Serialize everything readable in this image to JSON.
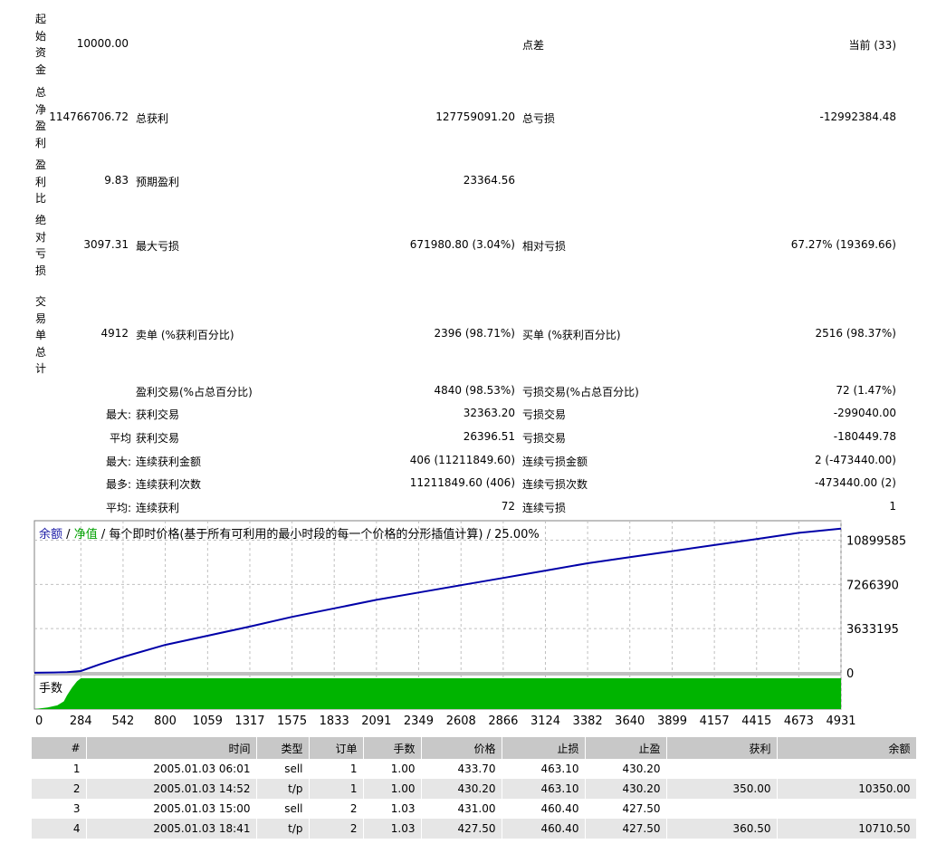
{
  "summary": {
    "initial_deposit": {
      "label": "起始资金",
      "value": "10000.00"
    },
    "spread": {
      "label": "点差",
      "value": "当前 (33)"
    },
    "net_profit": {
      "label": "总净盈利",
      "value": "114766706.72"
    },
    "gross_profit": {
      "label": "总获利",
      "value": "127759091.20"
    },
    "gross_loss": {
      "label": "总亏损",
      "value": "-12992384.48"
    },
    "profit_factor": {
      "label": "盈利比",
      "value": "9.83"
    },
    "expected_payoff": {
      "label": "预期盈利",
      "value": "23364.56"
    },
    "absolute_drawdown": {
      "label": "绝对亏损",
      "value": "3097.31"
    },
    "max_drawdown": {
      "label": "最大亏损",
      "value": "671980.80 (3.04%)"
    },
    "relative_drawdown": {
      "label": "相对亏损",
      "value": "67.27% (19369.66)"
    },
    "total_trades": {
      "label": "交易单总计",
      "value": "4912"
    },
    "short_positions": {
      "label": "卖单 (%获利百分比)",
      "value": "2396 (98.71%)"
    },
    "long_positions": {
      "label": "买单 (%获利百分比)",
      "value": "2516 (98.37%)"
    },
    "profit_trades": {
      "label": "盈利交易(%占总百分比)",
      "value": "4840 (98.53%)"
    },
    "loss_trades": {
      "label": "亏损交易(%占总百分比)",
      "value": "72 (1.47%)"
    },
    "largest_prefix": "最大:",
    "largest_profit": {
      "label": "获利交易",
      "value": "32363.20"
    },
    "largest_loss": {
      "label": "亏损交易",
      "value": "-299040.00"
    },
    "average_prefix": "平均",
    "average_profit": {
      "label": "获利交易",
      "value": "26396.51"
    },
    "average_loss": {
      "label": "亏损交易",
      "value": "-180449.78"
    },
    "max_prefix": "最大:",
    "max_consec_wins": {
      "label": "连续获利金额",
      "value": "406 (11211849.60)"
    },
    "max_consec_losses": {
      "label": "连续亏损金额",
      "value": "2 (-473440.00)"
    },
    "maximal_prefix": "最多:",
    "maximal_consec_profit": {
      "label": "连续获利次数",
      "value": "11211849.60 (406)"
    },
    "maximal_consec_loss": {
      "label": "连续亏损次数",
      "value": "-473440.00 (2)"
    },
    "avg_prefix": "平均:",
    "avg_consec_wins": {
      "label": "连续获利",
      "value": "72"
    },
    "avg_consec_losses": {
      "label": "连续亏损",
      "value": "1"
    }
  },
  "chart_data": {
    "type": "line",
    "title_balance": "余额",
    "title_equity": "净值",
    "title_sep": "/",
    "title_rest": "/ 每个即时价格(基于所有可利用的最小时段的每一个价格的分形插值计算) / 25.00%",
    "balance_color": "#1a1aa6",
    "equity_color": "#00a000",
    "line_color": "#0000a8",
    "volume_color": "#00b400",
    "y_tick_labels": [
      "10899585",
      "7266390",
      "3633195",
      "0"
    ],
    "y_ticks": [
      10899585,
      7266390,
      3633195,
      0
    ],
    "ylim": [
      0,
      12500000
    ],
    "x_tick_labels": [
      "0",
      "284",
      "542",
      "800",
      "1059",
      "1317",
      "1575",
      "1833",
      "2091",
      "2349",
      "2608",
      "2866",
      "3124",
      "3382",
      "3640",
      "3899",
      "4157",
      "4415",
      "4673",
      "4931"
    ],
    "xlim": [
      0,
      4931
    ],
    "series": [
      {
        "x": [
          0,
          120,
          200,
          284,
          400,
          542,
          800,
          1059,
          1317,
          1575,
          1833,
          2091,
          2349,
          2608,
          2866,
          3124,
          3382,
          3640,
          3899,
          4157,
          4415,
          4673,
          4931
        ],
        "y": [
          10000,
          30000,
          60000,
          150000,
          700000,
          1300000,
          2300000,
          3050000,
          3800000,
          4600000,
          5300000,
          6000000,
          6600000,
          7200000,
          7800000,
          8400000,
          9000000,
          9500000,
          10000000,
          10500000,
          11000000,
          11500000,
          11850000
        ]
      }
    ],
    "volume_label": "手数",
    "volume_x": [
      0,
      80,
      140,
      180,
      200,
      230,
      260,
      284,
      320,
      4931
    ],
    "volume_level": [
      0,
      0.05,
      0.12,
      0.25,
      0.45,
      0.7,
      0.9,
      1,
      1,
      1
    ]
  },
  "trades": {
    "headers": [
      "#",
      "时间",
      "类型",
      "订单",
      "手数",
      "价格",
      "止损",
      "止盈",
      "获利",
      "余额"
    ],
    "rows": [
      [
        "1",
        "2005.01.03 06:01",
        "sell",
        "1",
        "1.00",
        "433.70",
        "463.10",
        "430.20",
        "",
        ""
      ],
      [
        "2",
        "2005.01.03 14:52",
        "t/p",
        "1",
        "1.00",
        "430.20",
        "463.10",
        "430.20",
        "350.00",
        "10350.00"
      ],
      [
        "3",
        "2005.01.03 15:00",
        "sell",
        "2",
        "1.03",
        "431.00",
        "460.40",
        "427.50",
        "",
        ""
      ],
      [
        "4",
        "2005.01.03 18:41",
        "t/p",
        "2",
        "1.03",
        "427.50",
        "460.40",
        "427.50",
        "360.50",
        "10710.50"
      ]
    ]
  }
}
